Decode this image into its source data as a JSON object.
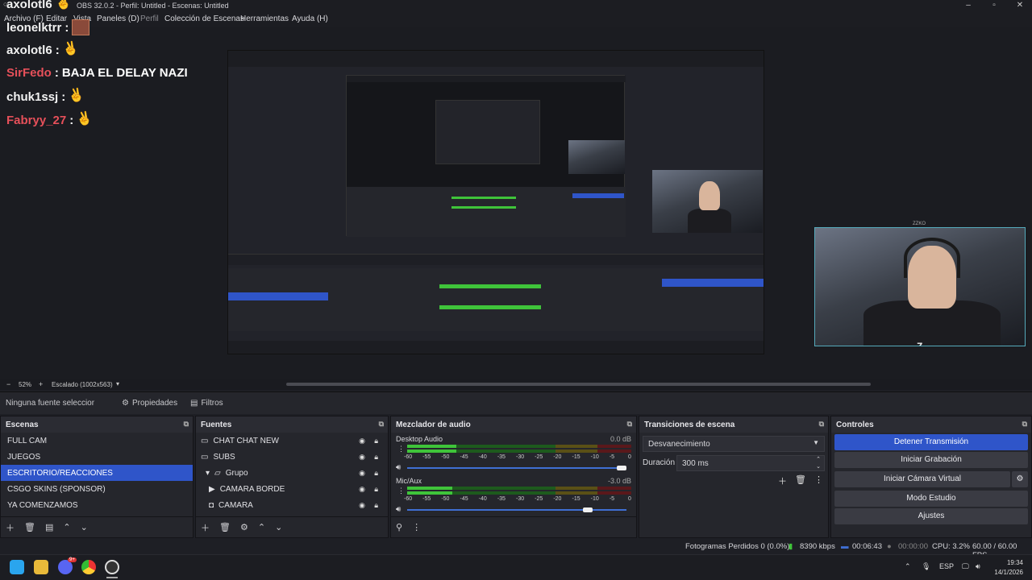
{
  "window": {
    "title": "OBS 32.0.2 - Perfil: Untitled - Escenas: Untitled",
    "controls": [
      "minimize-icon",
      "maximize-icon",
      "close-icon"
    ]
  },
  "menu": [
    "Archivo (F)",
    "Editar",
    "Vista",
    "Paneles (D)",
    "Perfil",
    "Colección de Escenas",
    "Herramientas",
    "Ayuda (H)"
  ],
  "chat": [
    {
      "user": "leonelktrr",
      "sep": ":",
      "emote": "avatar"
    },
    {
      "user": "axolotl6",
      "sep": ":",
      "emote": "frog"
    },
    {
      "user": "SirFedo",
      "sep": ":",
      "message": "BAJA EL DELAY NAZI",
      "color": "red"
    },
    {
      "user": "chuk1ssj",
      "sep": ":",
      "emote": "frog"
    },
    {
      "user": "Fabryy_27",
      "sep": ":",
      "emote": "frog",
      "color": "red"
    }
  ],
  "chat_overlay_top": {
    "user": "axolotl6"
  },
  "webcam": {
    "label": "ZZKO"
  },
  "preview_bar": {
    "minus": "−",
    "zoom": "52%",
    "plus": "+",
    "scale": "Escalado (1002x563)"
  },
  "source_bar": {
    "selection": "Ninguna fuente seleccionada",
    "properties": "Propiedades",
    "filters": "Filtros"
  },
  "scenes": {
    "title": "Escenas",
    "items": [
      "FULL CAM",
      "JUEGOS",
      "ESCRITORIO/REACCIONES",
      "CSGO SKINS (SPONSOR)",
      "YA COMENZAMOS"
    ],
    "selected": 2
  },
  "sources": {
    "title": "Fuentes",
    "items": [
      {
        "label": "CHAT CHAT NEW",
        "icon": "window-capture-icon",
        "indent": 0
      },
      {
        "label": "SUBS",
        "icon": "window-capture-icon",
        "indent": 0
      },
      {
        "label": "Grupo",
        "icon": "folder-icon",
        "indent": 1,
        "expander": "▾"
      },
      {
        "label": "CAMARA BORDE",
        "icon": "play-icon",
        "indent": 2
      },
      {
        "label": "CAMARA",
        "icon": "camera-icon",
        "indent": 1
      }
    ]
  },
  "mixer": {
    "title": "Mezclador de audio",
    "channels": [
      {
        "name": "Desktop Audio",
        "db": "0.0 dB",
        "level": 0.22,
        "volume": 1.0
      },
      {
        "name": "Mic/Aux",
        "db": "-3.0 dB",
        "level": 0.2,
        "volume": 0.84
      }
    ],
    "ticks": [
      "-60",
      "-55",
      "-50",
      "-45",
      "-40",
      "-35",
      "-30",
      "-25",
      "-20",
      "-15",
      "-10",
      "-5",
      "0"
    ]
  },
  "transitions": {
    "title": "Transiciones de escena",
    "selected": "Desvanecimiento",
    "duration_label": "Duración",
    "duration_value": "300 ms"
  },
  "controls": {
    "title": "Controles",
    "stop_stream": "Detener Transmisión",
    "start_record": "Iniciar Grabación",
    "start_vcam": "Iniciar Cámara Virtual",
    "studio_mode": "Modo Estudio",
    "settings": "Ajustes"
  },
  "status": {
    "dropped": "Fotogramas Perdidos 0 (0.0%)",
    "bitrate": "8390 kbps",
    "stream_time": "00:06:43",
    "rec_time": "00:00:00",
    "cpu": "CPU: 3.2%",
    "fps": "60.00 / 60.00 FPS"
  },
  "taskbar": {
    "lang": "ESP",
    "time": "19:34",
    "date": "14/1/2026",
    "discord_badge": "9+"
  },
  "colors": {
    "accent": "#2f55c9",
    "meter_green": "#3fc43a",
    "meter_yellow": "#b8a62a",
    "meter_red": "#b8282e"
  }
}
